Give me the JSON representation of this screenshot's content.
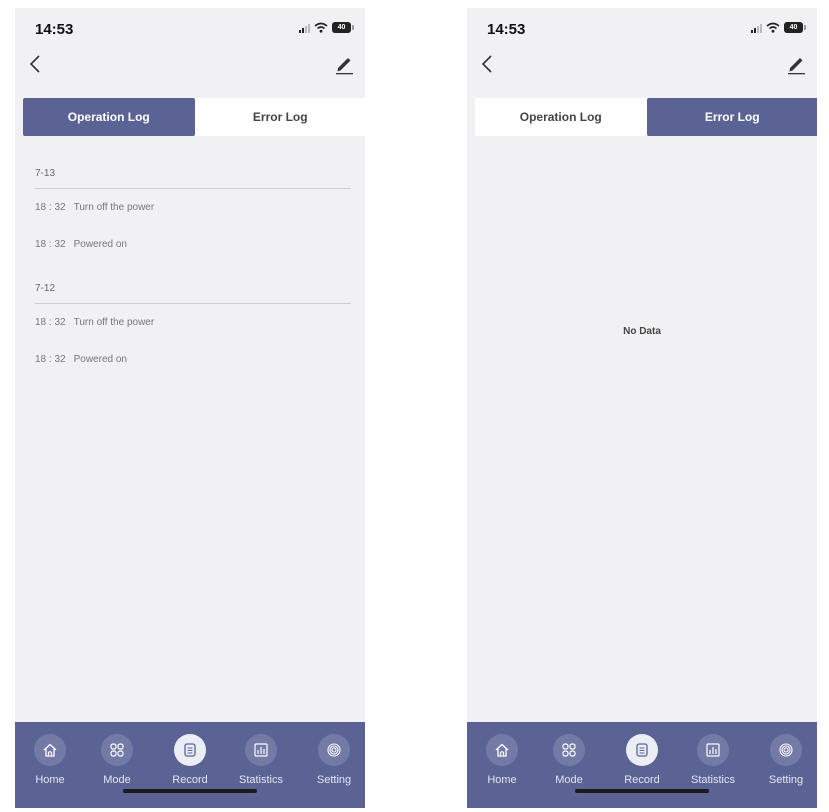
{
  "colors": {
    "accent": "#5b6395",
    "background": "#f1f1f3"
  },
  "status_bar": {
    "time": "14:53",
    "battery": "40"
  },
  "tabs": {
    "operation": "Operation Log",
    "error": "Error Log"
  },
  "operation_log": [
    {
      "date": "7-13",
      "entries": [
        {
          "time": "18 : 32",
          "text": "Turn off the power"
        },
        {
          "time": "18 : 32",
          "text": "Powered on"
        }
      ]
    },
    {
      "date": "7-12",
      "entries": [
        {
          "time": "18 : 32",
          "text": "Turn off the power"
        },
        {
          "time": "18 : 32",
          "text": "Powered on"
        }
      ]
    }
  ],
  "error_log": {
    "empty_text": "No Data"
  },
  "tabbar": [
    {
      "label": "Home",
      "icon": "home-icon"
    },
    {
      "label": "Mode",
      "icon": "grid-icon"
    },
    {
      "label": "Record",
      "icon": "document-icon"
    },
    {
      "label": "Statistics",
      "icon": "bar-chart-icon"
    },
    {
      "label": "Setting",
      "icon": "target-icon"
    }
  ],
  "screens": [
    {
      "name": "operation-log-screen",
      "active_tab": "operation"
    },
    {
      "name": "error-log-screen",
      "active_tab": "error"
    }
  ],
  "active_bottom_tab": "Record"
}
